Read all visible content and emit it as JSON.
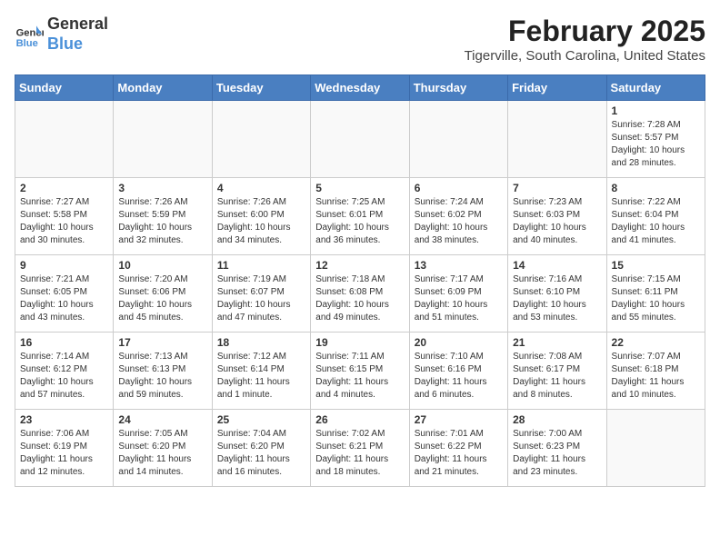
{
  "header": {
    "logo_line1": "General",
    "logo_line2": "Blue",
    "month": "February 2025",
    "location": "Tigerville, South Carolina, United States"
  },
  "weekdays": [
    "Sunday",
    "Monday",
    "Tuesday",
    "Wednesday",
    "Thursday",
    "Friday",
    "Saturday"
  ],
  "weeks": [
    [
      {
        "num": "",
        "info": ""
      },
      {
        "num": "",
        "info": ""
      },
      {
        "num": "",
        "info": ""
      },
      {
        "num": "",
        "info": ""
      },
      {
        "num": "",
        "info": ""
      },
      {
        "num": "",
        "info": ""
      },
      {
        "num": "1",
        "info": "Sunrise: 7:28 AM\nSunset: 5:57 PM\nDaylight: 10 hours\nand 28 minutes."
      }
    ],
    [
      {
        "num": "2",
        "info": "Sunrise: 7:27 AM\nSunset: 5:58 PM\nDaylight: 10 hours\nand 30 minutes."
      },
      {
        "num": "3",
        "info": "Sunrise: 7:26 AM\nSunset: 5:59 PM\nDaylight: 10 hours\nand 32 minutes."
      },
      {
        "num": "4",
        "info": "Sunrise: 7:26 AM\nSunset: 6:00 PM\nDaylight: 10 hours\nand 34 minutes."
      },
      {
        "num": "5",
        "info": "Sunrise: 7:25 AM\nSunset: 6:01 PM\nDaylight: 10 hours\nand 36 minutes."
      },
      {
        "num": "6",
        "info": "Sunrise: 7:24 AM\nSunset: 6:02 PM\nDaylight: 10 hours\nand 38 minutes."
      },
      {
        "num": "7",
        "info": "Sunrise: 7:23 AM\nSunset: 6:03 PM\nDaylight: 10 hours\nand 40 minutes."
      },
      {
        "num": "8",
        "info": "Sunrise: 7:22 AM\nSunset: 6:04 PM\nDaylight: 10 hours\nand 41 minutes."
      }
    ],
    [
      {
        "num": "9",
        "info": "Sunrise: 7:21 AM\nSunset: 6:05 PM\nDaylight: 10 hours\nand 43 minutes."
      },
      {
        "num": "10",
        "info": "Sunrise: 7:20 AM\nSunset: 6:06 PM\nDaylight: 10 hours\nand 45 minutes."
      },
      {
        "num": "11",
        "info": "Sunrise: 7:19 AM\nSunset: 6:07 PM\nDaylight: 10 hours\nand 47 minutes."
      },
      {
        "num": "12",
        "info": "Sunrise: 7:18 AM\nSunset: 6:08 PM\nDaylight: 10 hours\nand 49 minutes."
      },
      {
        "num": "13",
        "info": "Sunrise: 7:17 AM\nSunset: 6:09 PM\nDaylight: 10 hours\nand 51 minutes."
      },
      {
        "num": "14",
        "info": "Sunrise: 7:16 AM\nSunset: 6:10 PM\nDaylight: 10 hours\nand 53 minutes."
      },
      {
        "num": "15",
        "info": "Sunrise: 7:15 AM\nSunset: 6:11 PM\nDaylight: 10 hours\nand 55 minutes."
      }
    ],
    [
      {
        "num": "16",
        "info": "Sunrise: 7:14 AM\nSunset: 6:12 PM\nDaylight: 10 hours\nand 57 minutes."
      },
      {
        "num": "17",
        "info": "Sunrise: 7:13 AM\nSunset: 6:13 PM\nDaylight: 10 hours\nand 59 minutes."
      },
      {
        "num": "18",
        "info": "Sunrise: 7:12 AM\nSunset: 6:14 PM\nDaylight: 11 hours\nand 1 minute."
      },
      {
        "num": "19",
        "info": "Sunrise: 7:11 AM\nSunset: 6:15 PM\nDaylight: 11 hours\nand 4 minutes."
      },
      {
        "num": "20",
        "info": "Sunrise: 7:10 AM\nSunset: 6:16 PM\nDaylight: 11 hours\nand 6 minutes."
      },
      {
        "num": "21",
        "info": "Sunrise: 7:08 AM\nSunset: 6:17 PM\nDaylight: 11 hours\nand 8 minutes."
      },
      {
        "num": "22",
        "info": "Sunrise: 7:07 AM\nSunset: 6:18 PM\nDaylight: 11 hours\nand 10 minutes."
      }
    ],
    [
      {
        "num": "23",
        "info": "Sunrise: 7:06 AM\nSunset: 6:19 PM\nDaylight: 11 hours\nand 12 minutes."
      },
      {
        "num": "24",
        "info": "Sunrise: 7:05 AM\nSunset: 6:20 PM\nDaylight: 11 hours\nand 14 minutes."
      },
      {
        "num": "25",
        "info": "Sunrise: 7:04 AM\nSunset: 6:20 PM\nDaylight: 11 hours\nand 16 minutes."
      },
      {
        "num": "26",
        "info": "Sunrise: 7:02 AM\nSunset: 6:21 PM\nDaylight: 11 hours\nand 18 minutes."
      },
      {
        "num": "27",
        "info": "Sunrise: 7:01 AM\nSunset: 6:22 PM\nDaylight: 11 hours\nand 21 minutes."
      },
      {
        "num": "28",
        "info": "Sunrise: 7:00 AM\nSunset: 6:23 PM\nDaylight: 11 hours\nand 23 minutes."
      },
      {
        "num": "",
        "info": ""
      }
    ]
  ]
}
